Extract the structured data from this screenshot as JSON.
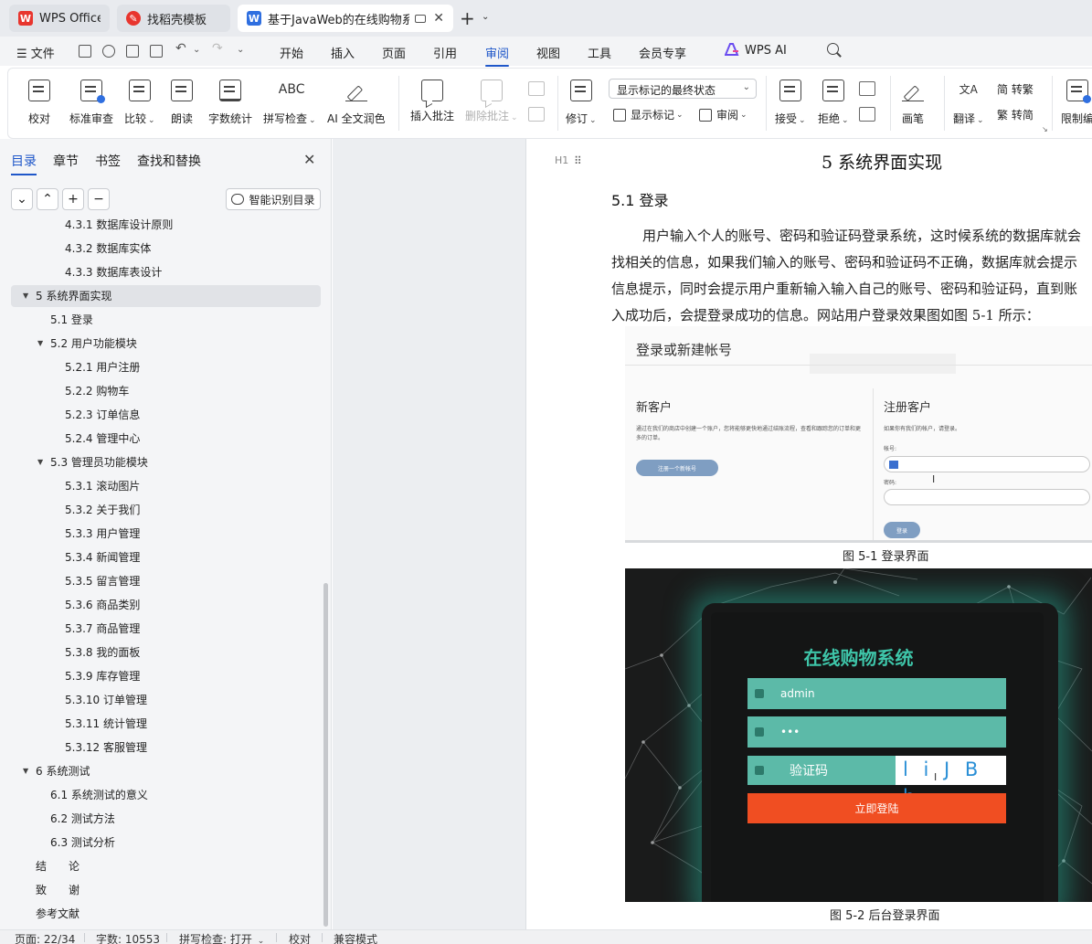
{
  "tabs": [
    {
      "label": "WPS Office",
      "icon": "wps-logo-icon",
      "color": "#e8352e"
    },
    {
      "label": "找稻壳模板",
      "icon": "docer-icon",
      "color": "#e8352e"
    },
    {
      "label": "基于JavaWeb的在线购物系统",
      "icon": "word-doc-icon",
      "color": "#2f6fe0"
    }
  ],
  "menu": {
    "file": "文件",
    "items": [
      "开始",
      "插入",
      "页面",
      "引用",
      "审阅",
      "视图",
      "工具",
      "会员专享"
    ],
    "active": "审阅",
    "wps_ai": "WPS AI"
  },
  "ribbon": {
    "proofread": "校对",
    "standard_review": "标准审查",
    "compare": "比较",
    "read_aloud": "朗读",
    "word_count": "字数统计",
    "spell_check": "拼写检查",
    "spell_check_icon_text": "ABC",
    "ai_polish": "AI 全文润色",
    "insert_comment": "插入批注",
    "delete_comment": "删除批注",
    "track_changes": "修订",
    "markup_display": "显示标记的最终状态",
    "show_markup": "显示标记",
    "review_pane": "审阅",
    "accept": "接受",
    "reject": "拒绝",
    "pen": "画笔",
    "translate": "翻译",
    "to_traditional": "简 转繁",
    "to_simplified": "繁 转简",
    "restrict_edit": "限制编"
  },
  "nav": {
    "tabs": [
      "目录",
      "章节",
      "书签",
      "查找和替换"
    ],
    "active_tab": "目录",
    "smart_toc": "智能识别目录",
    "toc": [
      {
        "label": "4.3.1 数据库设计原则",
        "level": 3
      },
      {
        "label": "4.3.2 数据库实体",
        "level": 3
      },
      {
        "label": "4.3.3 数据库表设计",
        "level": 3
      },
      {
        "label": "5 系统界面实现",
        "level": 1,
        "expanded": true,
        "selected": true
      },
      {
        "label": "5.1 登录",
        "level": 2
      },
      {
        "label": "5.2 用户功能模块",
        "level": 2,
        "expanded": true
      },
      {
        "label": "5.2.1 用户注册",
        "level": 3
      },
      {
        "label": "5.2.2 购物车",
        "level": 3
      },
      {
        "label": "5.2.3 订单信息",
        "level": 3
      },
      {
        "label": "5.2.4 管理中心",
        "level": 3
      },
      {
        "label": "5.3 管理员功能模块",
        "level": 2,
        "expanded": true
      },
      {
        "label": "5.3.1 滚动图片",
        "level": 3
      },
      {
        "label": "5.3.2 关于我们",
        "level": 3
      },
      {
        "label": "5.3.3 用户管理",
        "level": 3
      },
      {
        "label": "5.3.4 新闻管理",
        "level": 3
      },
      {
        "label": "5.3.5 留言管理",
        "level": 3
      },
      {
        "label": "5.3.6 商品类别",
        "level": 3
      },
      {
        "label": "5.3.7 商品管理",
        "level": 3
      },
      {
        "label": "5.3.8 我的面板",
        "level": 3
      },
      {
        "label": "5.3.9 库存管理",
        "level": 3
      },
      {
        "label": "5.3.10 订单管理",
        "level": 3
      },
      {
        "label": "5.3.11 统计管理",
        "level": 3
      },
      {
        "label": "5.3.12 客服管理",
        "level": 3
      },
      {
        "label": "6 系统测试",
        "level": 1,
        "expanded": true
      },
      {
        "label": "6.1 系统测试的意义",
        "level": 2
      },
      {
        "label": "6.2 测试方法",
        "level": 2
      },
      {
        "label": "6.3 测试分析",
        "level": 2
      },
      {
        "label": "结　　论",
        "level": 1
      },
      {
        "label": "致　　谢",
        "level": 1
      },
      {
        "label": "参考文献",
        "level": 1
      }
    ]
  },
  "doc": {
    "heading_marker": "H1",
    "h1": "5 系统界面实现",
    "h2": "5.1  登录",
    "paragraph_lines": [
      "用户输入个人的账号、密码和验证码登录系统，这时候系统的数据库就会",
      "找相关的信息，如果我们输入的账号、密码和验证码不正确，数据库就会提示",
      "信息提示，同时会提示用户重新输入输入自己的账号、密码和验证码，直到账",
      "入成功后，会提登录成功的信息。网站用户登录效果图如图 5-1 所示："
    ],
    "fig1": {
      "title": "登录或新建帐号",
      "new_customer": "新客户",
      "new_customer_desc": "通过在我们的商店中创建一个账户，您将能够更快地通过结账流程，查看和跟踪您的订单和更多的订单。",
      "register_button": "注册一个新帐号",
      "registered_customer": "注册客户",
      "registered_desc": "如果你有我们的帐户，请登录。",
      "account_label": "帐号:",
      "password_label": "密码:",
      "login_button": "登录",
      "caption": "图 5-1 登录界面"
    },
    "fig2": {
      "app_title": "在线购物系统",
      "username": "admin",
      "password": "•••",
      "captcha_label": "验证码",
      "captcha_code": "l i J B b",
      "login_button": "立即登陆",
      "caption": "图 5-2 后台登录界面"
    }
  },
  "status": {
    "page": "页面: 22/34",
    "words": "字数: 10553",
    "spell": "拼写检查: 打开",
    "proof": "校对",
    "compat": "兼容模式"
  }
}
